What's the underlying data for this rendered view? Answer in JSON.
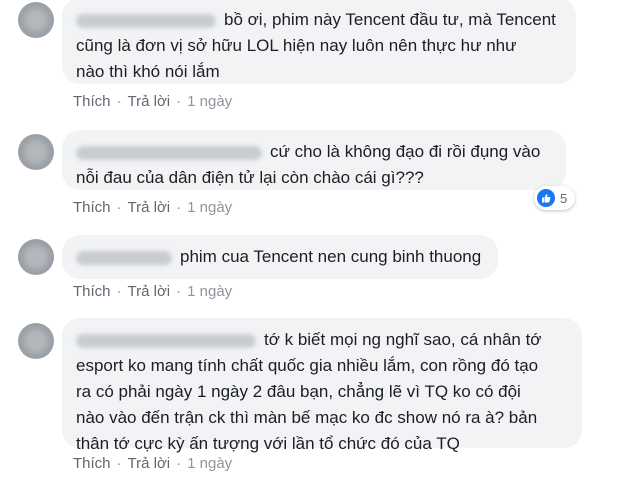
{
  "comments": [
    {
      "text": "bồ ơi, phim này Tencent đầu tư, mà Tencent\ncũng là đơn vị sở hữu LOL hiện nay luôn nên thực hư như\nnào thì khó nói lắm",
      "like_label": "Thích",
      "reply_label": "Trả lời",
      "time": "1 ngày"
    },
    {
      "text": "cứ cho là không đạo đi rồi đụng vào\nnỗi đau của dân điện tử lại còn chào cái gì???",
      "like_label": "Thích",
      "reply_label": "Trả lời",
      "time": "1 ngày",
      "reaction_icon": "like-icon",
      "reaction_count": "5"
    },
    {
      "text": "phim cua Tencent nen cung binh thuong",
      "like_label": "Thích",
      "reply_label": "Trả lời",
      "time": "1 ngày"
    },
    {
      "text": "tớ k biết mọi ng nghĩ sao, cá nhân tớ\nesport ko mang tính chất quốc gia nhiều lắm, con rồng đó tạo\nra có phải ngày 1 ngày 2 đâu bạn, chẳng lẽ vì TQ ko có đội\nnào vào đến trận ck thì màn bế mạc ko đc show nó ra à? bản\nthân tớ cực kỳ ấn tượng với lần tổ chức đó của TQ",
      "like_label": "Thích",
      "reply_label": "Trả lời",
      "time": "1 ngày"
    }
  ],
  "separator": "·",
  "colors": {
    "bubble": "#f2f3f5",
    "action_text": "#606770",
    "like_blue": "#1877f2"
  }
}
